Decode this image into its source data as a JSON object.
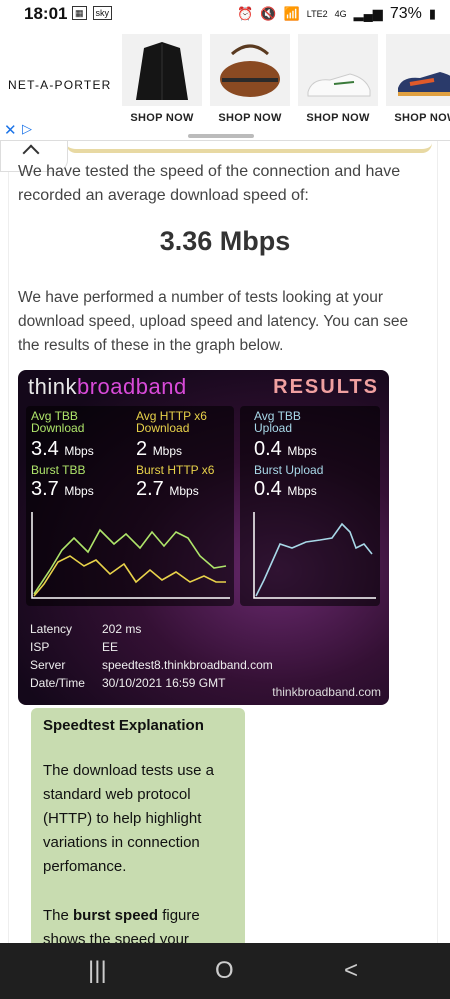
{
  "status": {
    "time": "18:01",
    "battery": "73%",
    "network": "4G",
    "lte": "LTE2"
  },
  "ad": {
    "brand": "NET-A-PORTER",
    "tiles": [
      {
        "label": "SHOP NOW",
        "icon": "jacket-image"
      },
      {
        "label": "SHOP NOW",
        "icon": "bag-image"
      },
      {
        "label": "SHOP NOW",
        "icon": "sneaker-white-image"
      },
      {
        "label": "SHOP NOW",
        "icon": "sneaker-colour-image"
      }
    ]
  },
  "article": {
    "intro": "We have tested the speed of the connection and have recorded an average download speed of:",
    "speed": "3.36 Mbps",
    "body": "We have performed a number of tests looking at your download speed, upload speed and latency. You can see the results of these in the graph below."
  },
  "speedtest": {
    "logo_left": "think",
    "logo_right": "broadband",
    "results_label": "RESULTS",
    "metrics": {
      "avg_tbb_label": "Avg TBB Download",
      "avg_tbb_value": "3.4",
      "avg_http_label": "Avg HTTP x6 Download",
      "avg_http_value": "2",
      "burst_tbb_label": "Burst TBB",
      "burst_tbb_value": "3.7",
      "burst_http_label": "Burst HTTP x6",
      "burst_http_value": "2.7",
      "avg_upload_label": "Avg TBB Upload",
      "avg_upload_value": "0.4",
      "burst_upload_label": "Burst Upload",
      "burst_upload_value": "0.4",
      "unit": "Mbps"
    },
    "info": {
      "latency_label": "Latency",
      "latency_value": "202 ms",
      "isp_label": "ISP",
      "isp_value": "EE",
      "server_label": "Server",
      "server_value": "speedtest8.thinkbroadband.com",
      "datetime_label": "Date/Time",
      "datetime_value": "30/10/2021 16:59 GMT"
    },
    "footer": "thinkbroadband.com",
    "colors": {
      "tbb": "#aee46a",
      "http": "#e8d24a",
      "upload": "#a8d8e8"
    }
  },
  "explanation": {
    "title": "Speedtest Explanation",
    "p1": "The download tests use a standard web protocol (HTTP) to help highlight variations in connection perfomance.",
    "p2_pre": "The ",
    "p2_bold": "burst speed",
    "p2_post": " figure shows the speed your"
  },
  "nav": {
    "recent": "|||",
    "home": "O",
    "back": "<"
  }
}
